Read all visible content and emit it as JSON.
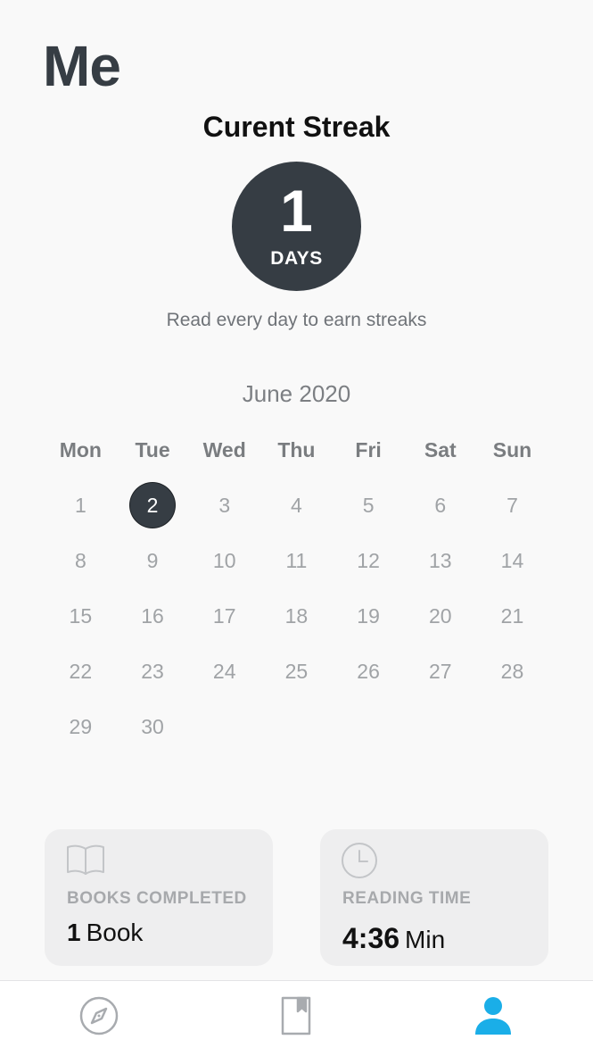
{
  "header": {
    "title": "Me"
  },
  "streak": {
    "title": "Curent Streak",
    "count": "1",
    "unit": "DAYS",
    "hint": "Read every day to earn streaks",
    "circle_color": "#363d44"
  },
  "calendar": {
    "month": "June 2020",
    "weekdays": [
      "Mon",
      "Tue",
      "Wed",
      "Thu",
      "Fri",
      "Sat",
      "Sun"
    ],
    "weeks": [
      [
        "1",
        "2",
        "3",
        "4",
        "5",
        "6",
        "7"
      ],
      [
        "8",
        "9",
        "10",
        "11",
        "12",
        "13",
        "14"
      ],
      [
        "15",
        "16",
        "17",
        "18",
        "19",
        "20",
        "21"
      ],
      [
        "22",
        "23",
        "24",
        "25",
        "26",
        "27",
        "28"
      ],
      [
        "29",
        "30",
        "",
        "",
        "",
        "",
        ""
      ]
    ],
    "highlighted_day": "2"
  },
  "stats": {
    "books": {
      "icon": "open-book-icon",
      "label": "BOOKS COMPLETED",
      "value": "1",
      "unit": "Book"
    },
    "time": {
      "icon": "clock-icon",
      "label": "READING TIME",
      "value": "4:36",
      "unit": "Min"
    }
  },
  "tabbar": {
    "items": [
      {
        "name": "discover",
        "icon": "compass-icon",
        "active": false
      },
      {
        "name": "library",
        "icon": "bookmark-book-icon",
        "active": false
      },
      {
        "name": "me",
        "icon": "person-icon",
        "active": true
      }
    ],
    "active_color": "#1aaee8",
    "inactive_color": "#a8abaf"
  }
}
